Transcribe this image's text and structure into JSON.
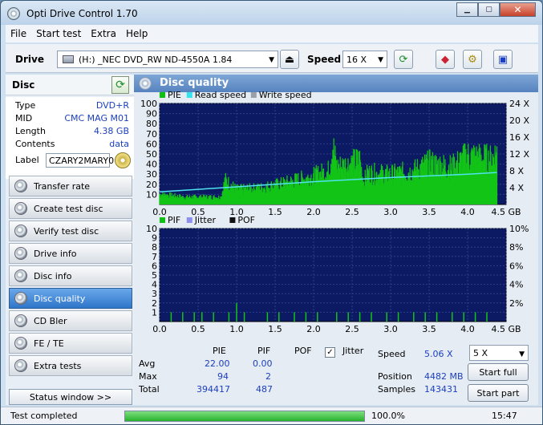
{
  "window": {
    "title": "Opti Drive Control 1.70"
  },
  "menu": [
    "File",
    "Start test",
    "Extra",
    "Help"
  ],
  "toolbar": {
    "drive_label": "Drive",
    "drive_value": "(H:)   _NEC DVD_RW ND-4550A 1.84",
    "speed_label": "Speed",
    "speed_value": "16 X"
  },
  "disc": {
    "header": "Disc",
    "type_label": "Type",
    "type_value": "DVD+R",
    "mid_label": "MID",
    "mid_value": "CMC MAG M01",
    "length_label": "Length",
    "length_value": "4.38 GB",
    "contents_label": "Contents",
    "contents_value": "data",
    "label_label": "Label",
    "label_value": "CZARY2MARY0"
  },
  "nav": [
    {
      "label": "Transfer rate",
      "active": false
    },
    {
      "label": "Create test disc",
      "active": false
    },
    {
      "label": "Verify test disc",
      "active": false
    },
    {
      "label": "Drive info",
      "active": false
    },
    {
      "label": "Disc info",
      "active": false
    },
    {
      "label": "Disc quality",
      "active": true
    },
    {
      "label": "CD Bler",
      "active": false
    },
    {
      "label": "FE / TE",
      "active": false
    },
    {
      "label": "Extra tests",
      "active": false
    }
  ],
  "status_window_label": "Status window >>",
  "panel": {
    "title": "Disc quality"
  },
  "chart_data": [
    {
      "type": "bar",
      "legend": [
        "PIE",
        "Read speed",
        "Write speed"
      ],
      "x_ticks": [
        "0.0",
        "0.5",
        "1.0",
        "1.5",
        "2.0",
        "2.5",
        "3.0",
        "3.5",
        "4.0",
        "4.5 GB"
      ],
      "y_ticks_left": [
        "10",
        "20",
        "30",
        "40",
        "50",
        "60",
        "70",
        "80",
        "90",
        "100"
      ],
      "y_ticks_right": [
        "4 X",
        "8 X",
        "12 X",
        "16 X",
        "20 X",
        "24 X"
      ],
      "xlim": [
        0,
        4.5
      ],
      "ylim": [
        0,
        100
      ],
      "pie_envelope_x": [
        0.0,
        0.3,
        0.6,
        0.8,
        0.85,
        1.0,
        1.3,
        1.6,
        2.0,
        2.2,
        2.25,
        2.3,
        2.5,
        2.6,
        2.65,
        2.7,
        3.0,
        3.3,
        3.5,
        3.8,
        4.0,
        4.3,
        4.38
      ],
      "pie_envelope_y": [
        14,
        10,
        10,
        10,
        33,
        20,
        22,
        28,
        38,
        45,
        80,
        50,
        55,
        60,
        30,
        42,
        40,
        45,
        55,
        50,
        65,
        60,
        70
      ],
      "read_speed_x": [
        0.0,
        1.0,
        2.0,
        3.0,
        4.0,
        4.38
      ],
      "read_speed_x_speed": [
        3.0,
        4.2,
        5.4,
        6.4,
        7.2,
        7.6
      ]
    },
    {
      "type": "bar",
      "legend": [
        "PIF",
        "Jitter",
        "POF"
      ],
      "x_ticks": [
        "0.0",
        "0.5",
        "1.0",
        "1.5",
        "2.0",
        "2.5",
        "3.0",
        "3.5",
        "4.0",
        "4.5 GB"
      ],
      "y_ticks_left": [
        "1",
        "2",
        "3",
        "4",
        "5",
        "6",
        "7",
        "8",
        "9",
        "10"
      ],
      "y_ticks_right": [
        "2%",
        "4%",
        "6%",
        "8%",
        "10%"
      ],
      "xlim": [
        0,
        4.5
      ],
      "ylim": [
        0,
        10
      ],
      "pif_x": [
        0.15,
        0.3,
        0.45,
        0.55,
        0.7,
        0.9,
        1.0,
        1.1,
        1.4,
        1.55,
        1.75,
        1.9,
        2.05,
        2.3,
        2.45,
        2.6,
        2.75,
        2.95,
        3.1,
        3.3,
        3.45,
        3.6,
        3.8,
        3.95,
        4.1,
        4.25
      ],
      "pif_y": [
        1,
        1,
        1,
        1,
        1,
        1,
        2,
        1,
        1,
        1,
        1,
        1,
        1,
        1,
        1,
        1,
        1,
        1,
        1,
        1,
        1,
        1,
        1,
        1,
        1,
        1
      ]
    }
  ],
  "stats": {
    "col_pie": "PIE",
    "col_pif": "PIF",
    "col_pof": "POF",
    "col_jitter": "Jitter",
    "avg_label": "Avg",
    "avg_pie": "22.00",
    "avg_pif": "0.00",
    "max_label": "Max",
    "max_pie": "94",
    "max_pif": "2",
    "total_label": "Total",
    "total_pie": "394417",
    "total_pif": "487",
    "speed_label": "Speed",
    "speed_value": "5.06 X",
    "speed_select": "5 X",
    "position_label": "Position",
    "position_value": "4482 MB",
    "samples_label": "Samples",
    "samples_value": "143431",
    "start_full": "Start full",
    "start_part": "Start part"
  },
  "statusbar": {
    "text": "Test completed",
    "progress": 100.0,
    "percent_text": "100.0%",
    "time": "15:47"
  }
}
